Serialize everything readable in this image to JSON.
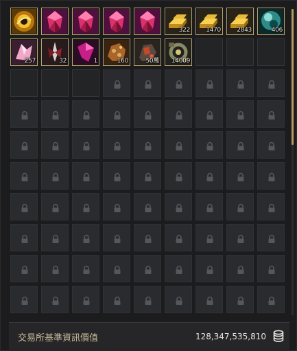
{
  "inventory": {
    "items": [
      {
        "name": "glowing-orb-icon",
        "qty": ""
      },
      {
        "name": "pink-crystal-icon",
        "qty": ""
      },
      {
        "name": "pink-crystal-icon",
        "qty": ""
      },
      {
        "name": "pink-crystal-icon",
        "qty": ""
      },
      {
        "name": "pink-crystal-icon",
        "qty": ""
      },
      {
        "name": "gold-bar-icon",
        "qty": "322"
      },
      {
        "name": "gold-bar-icon",
        "qty": "1470"
      },
      {
        "name": "gold-bar-icon",
        "qty": "2843"
      },
      {
        "name": "teal-orb-icon",
        "qty": "406"
      },
      {
        "name": "pink-shard-icon",
        "qty": "257"
      },
      {
        "name": "dark-blade-icon",
        "qty": "32"
      },
      {
        "name": "magenta-shard-icon",
        "qty": "1"
      },
      {
        "name": "ore-chunk-icon",
        "qty": "160"
      },
      {
        "name": "red-ore-icon",
        "qty": "50萬"
      },
      {
        "name": "gear-scrap-icon",
        "qty": "14009"
      }
    ]
  },
  "footer": {
    "label": "交易所基準資訊價值",
    "value": "128,347,535,810"
  },
  "colors": {
    "item_border": "#b8a36a",
    "scroll_thumb": "#b79a62",
    "footer_label": "#c7b99a"
  }
}
